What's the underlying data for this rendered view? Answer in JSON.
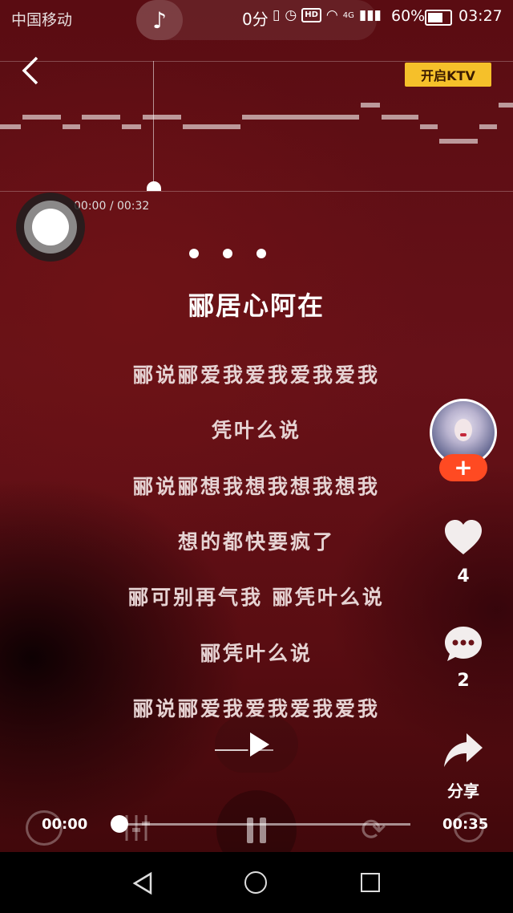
{
  "status_bar": {
    "carrier": "中国移动",
    "net_speed": "0分",
    "network": "4G",
    "battery_percent": "60%",
    "time": "03:27"
  },
  "header": {
    "ktv_button_label": "开启KTV",
    "sing_time": "00:00",
    "sing_time_separator": "/",
    "sing_duration": "00:32"
  },
  "lyrics": {
    "title": "郦居心阿在",
    "lines": [
      "郦说郦爱我爱我爱我爱我",
      "凭叶么说",
      "郦说郦想我想我想我想我",
      "想的都快要疯了",
      "郦可别再气我 郦凭叶么说",
      "郦凭叶么说",
      "郦说郦爱我爱我爱我爱我"
    ]
  },
  "sidebar": {
    "follow_label": "+",
    "like_count": "4",
    "comment_count": "2",
    "share_label": "分享"
  },
  "player": {
    "current_time": "00:00",
    "total_time": "00:35",
    "progress": 0.0
  },
  "icons": {
    "back": "chevron-left-icon",
    "music": "music-note-icon",
    "like": "heart-icon",
    "comment": "comment-bubble-icon",
    "share": "share-arrow-icon",
    "play": "play-icon",
    "pause": "pause-icon"
  },
  "colors": {
    "ktv_button": "#f5c02a",
    "follow_button": "#ff4a22",
    "background": "#661118"
  }
}
